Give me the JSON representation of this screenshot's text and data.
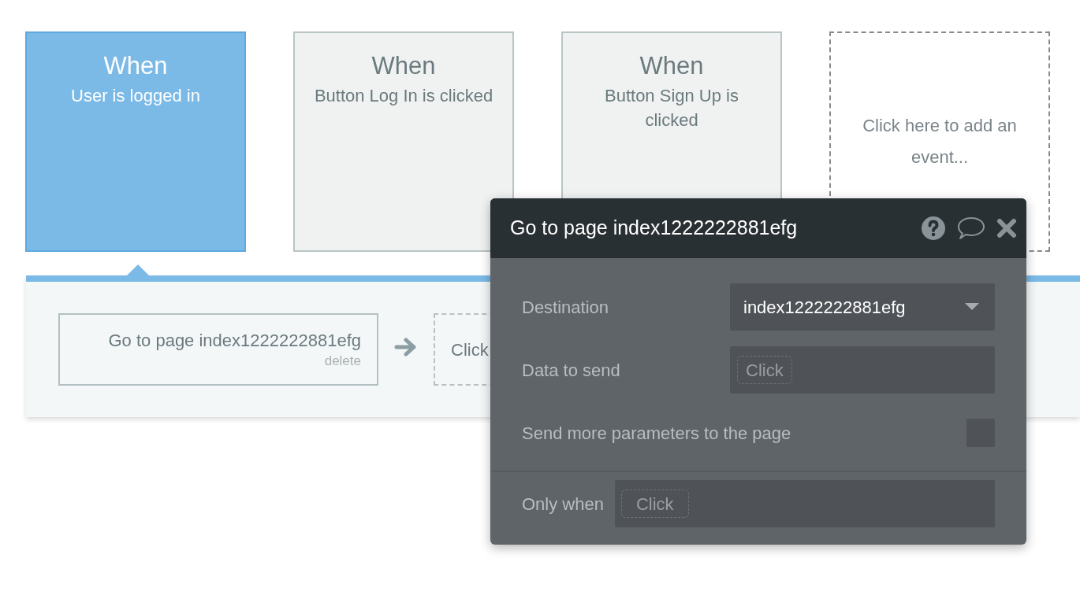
{
  "events": [
    {
      "kind": "event",
      "title": "When",
      "subtitle": "User is logged in",
      "selected": true
    },
    {
      "kind": "event",
      "title": "When",
      "subtitle": "Button Log In is clicked",
      "selected": false
    },
    {
      "kind": "event",
      "title": "When",
      "subtitle": "Button Sign Up is clicked",
      "selected": false
    },
    {
      "kind": "add",
      "label": "Click here to add an event..."
    }
  ],
  "actions": [
    {
      "kind": "action",
      "label": "Go to page index1222222881efg",
      "delete": "delete"
    },
    {
      "kind": "add",
      "label": "Click"
    }
  ],
  "popup": {
    "title": "Go to page index1222222881efg",
    "destination": {
      "label": "Destination",
      "value": "index1222222881efg"
    },
    "data_to_send": {
      "label": "Data to send",
      "placeholder": "Click"
    },
    "send_more": {
      "label": "Send more parameters to the page",
      "checked": false
    },
    "only_when": {
      "label": "Only when",
      "placeholder": "Click"
    }
  }
}
